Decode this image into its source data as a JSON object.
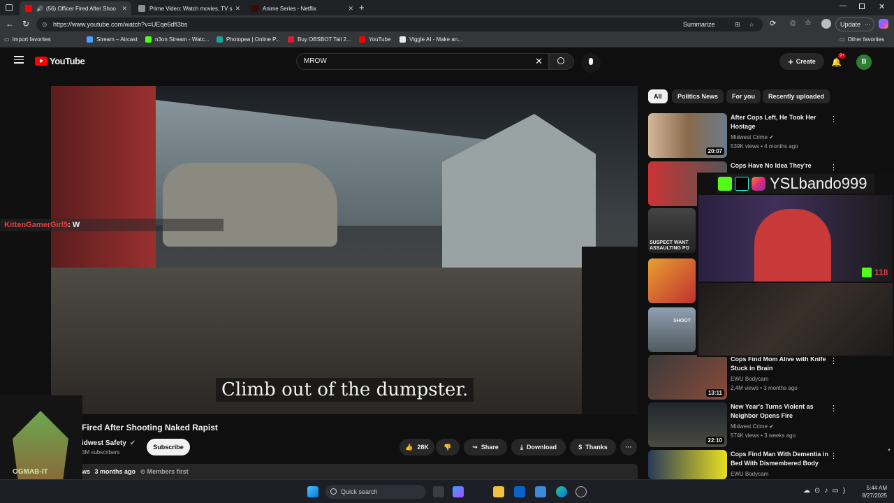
{
  "browser": {
    "tabs": [
      {
        "label": "(56) Officer Fired After Shoo",
        "active": true
      },
      {
        "label": "Prime Video: Watch movies, TV s",
        "active": false
      },
      {
        "label": "Anime Series - Netflix",
        "active": false
      }
    ],
    "url": "https://www.youtube.com/watch?v=UEqe6dfl3bs",
    "summarize_label": "Summarize",
    "update_label": "Update",
    "profile_initial": "",
    "bookmarks": [
      {
        "label": "Import favorites"
      },
      {
        "label": "Stream – Aircast"
      },
      {
        "label": "n3on Stream - Watc..."
      },
      {
        "label": "Photopea | Online P..."
      },
      {
        "label": "Buy OBSBOT Tail 2..."
      },
      {
        "label": "YouTube"
      },
      {
        "label": "Viggle AI - Make an..."
      }
    ],
    "other_favorites": "Other favorites"
  },
  "youtube": {
    "logo_text": "YouTube",
    "search_value": "MROW",
    "create_label": "Create",
    "notif_badge": "9+",
    "avatar_initial": "B",
    "chips": [
      "All",
      "Politics News",
      "For you",
      "Recently uploaded"
    ],
    "video": {
      "caption": "Climb out of the dumpster.",
      "title": "Fired After Shooting Naked Rapist",
      "channel": "idwest Safety",
      "subscribers": "3M subscribers",
      "subscribe_label": "Subscribe",
      "likes": "28K",
      "share_label": "Share",
      "download_label": "Download",
      "thanks_label": "Thanks",
      "views": "ws",
      "age": "3 months ago",
      "members": "Members first"
    },
    "recommendations": [
      {
        "title": "After Cops Left, He Took Her Hostage",
        "channel": "Midwest Crime",
        "meta": "539K views • 4 months ago",
        "duration": "20:07"
      },
      {
        "title": "Cops Have No Idea They're",
        "channel": "",
        "meta": "",
        "duration": ""
      },
      {
        "title": "",
        "channel": "",
        "meta": "",
        "duration": ""
      },
      {
        "title": "",
        "channel": "",
        "meta": "",
        "duration": ""
      },
      {
        "title": "",
        "channel": "",
        "meta": "",
        "duration": ""
      },
      {
        "title": "Cops Find Mom Alive with Knife Stuck in Brain",
        "channel": "EWU Bodycam",
        "meta": "2.4M views • 3 months ago",
        "duration": "13:11"
      },
      {
        "title": "New Year's Turns Violent as Neighbor Opens Fire",
        "channel": "Midwest Crime",
        "meta": "574K views • 3 weeks ago",
        "duration": "22:10"
      },
      {
        "title": "Cops Find Man With Dementia in Bed With Dismembered Body",
        "channel": "EWU Bodycam",
        "meta": "",
        "duration": ""
      }
    ],
    "thumb_overlays": [
      "SUSPECT WANT ASSAULTING PO",
      "SHOOT"
    ]
  },
  "stream_overlay": {
    "chat_user": "KittenGamerGirl5",
    "chat_msg": ": W",
    "handle": "YSLbando999",
    "viewer_count": "118",
    "logo_text": "OGMAB-IT"
  },
  "taskbar": {
    "search_placeholder": "Quick search",
    "time": "5:44 AM",
    "date": "8/27/2025"
  },
  "colors": {
    "yt_red": "#ff0000",
    "kick_green": "#53fc18",
    "avatar_green": "#2e7d32",
    "notif_red": "#cc0000"
  }
}
